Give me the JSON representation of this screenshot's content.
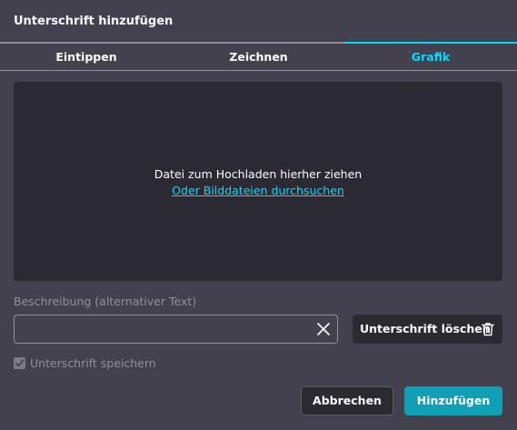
{
  "dialog": {
    "title": "Unterschrift hinzufügen"
  },
  "tabs": [
    {
      "label": "Eintippen",
      "active": false
    },
    {
      "label": "Zeichnen",
      "active": false
    },
    {
      "label": "Grafik",
      "active": true
    }
  ],
  "dropzone": {
    "text": "Datei zum Hochladen hierher ziehen",
    "link": "Oder Bilddateien durchsuchen"
  },
  "description": {
    "label": "Beschreibung (alternativer Text)",
    "value": "",
    "placeholder": ""
  },
  "delete_button": {
    "label": "Unterschrift löschen",
    "icon": "trash-icon"
  },
  "save_signature": {
    "label": "Unterschrift speichern",
    "checked": true,
    "disabled": true
  },
  "footer": {
    "cancel_label": "Abbrechen",
    "add_label": "Hinzufügen"
  },
  "colors": {
    "background": "#42414d",
    "dropzone": "#2b2a33",
    "accent": "#00ddff",
    "primary_button": "#0fa0b5"
  }
}
